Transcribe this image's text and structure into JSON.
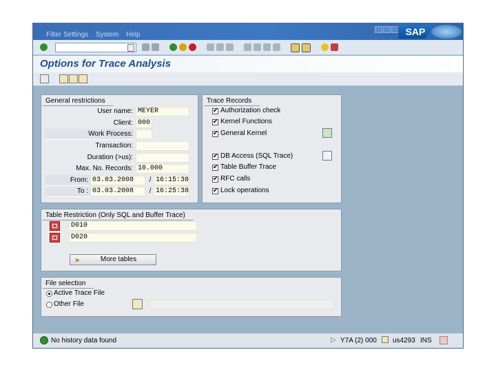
{
  "window": {
    "menu": [
      "Filter Settings",
      "System",
      "Help"
    ],
    "logo": "SAP"
  },
  "title": "Options for Trace Analysis",
  "general": {
    "title": "General restrictions",
    "user_label": "User name:",
    "user_value": "MEYER",
    "client_label": "Client:",
    "client_value": "000",
    "work_process_label": "Work Process:",
    "work_process_value": "",
    "transaction_label": "Transaction:",
    "transaction_value": "",
    "duration_label": "Duration (>us):",
    "duration_value": "",
    "max_records_label": "Max. No. Records:",
    "max_records_value": "10.000",
    "from_label": "From:",
    "from_date": "03.03.2008",
    "from_time": "16:15:38",
    "to_label": "To :",
    "to_date": "03.03.2008",
    "to_time": "16:25:38",
    "separator": "/"
  },
  "trace_records": {
    "title": "Trace Records",
    "items": [
      {
        "label": "Authorization check",
        "checked": true
      },
      {
        "label": "Kernel Functions",
        "checked": true
      },
      {
        "label": "General Kernel",
        "checked": true
      },
      {
        "label": "DB Access (SQL Trace)",
        "checked": true
      },
      {
        "label": "Table Buffer Trace",
        "checked": true
      },
      {
        "label": "RFC calls",
        "checked": true
      },
      {
        "label": "Lock operations",
        "checked": true
      }
    ]
  },
  "table_restriction": {
    "title": "Table Restriction (Only SQL and Buffer Trace)",
    "rows": [
      "D010",
      "D020"
    ],
    "more_button": "More tables"
  },
  "file_selection": {
    "title": "File selection",
    "active_label": "Active Trace File",
    "other_label": "Other File",
    "selected": "active"
  },
  "status": {
    "message": "No history data found",
    "system": "Y7A (2) 000",
    "server": "us4293",
    "mode": "INS"
  },
  "colors": {
    "title_text": "#1f4f8f",
    "background": "#9bb4c8",
    "group_bg": "#e8eaed"
  }
}
